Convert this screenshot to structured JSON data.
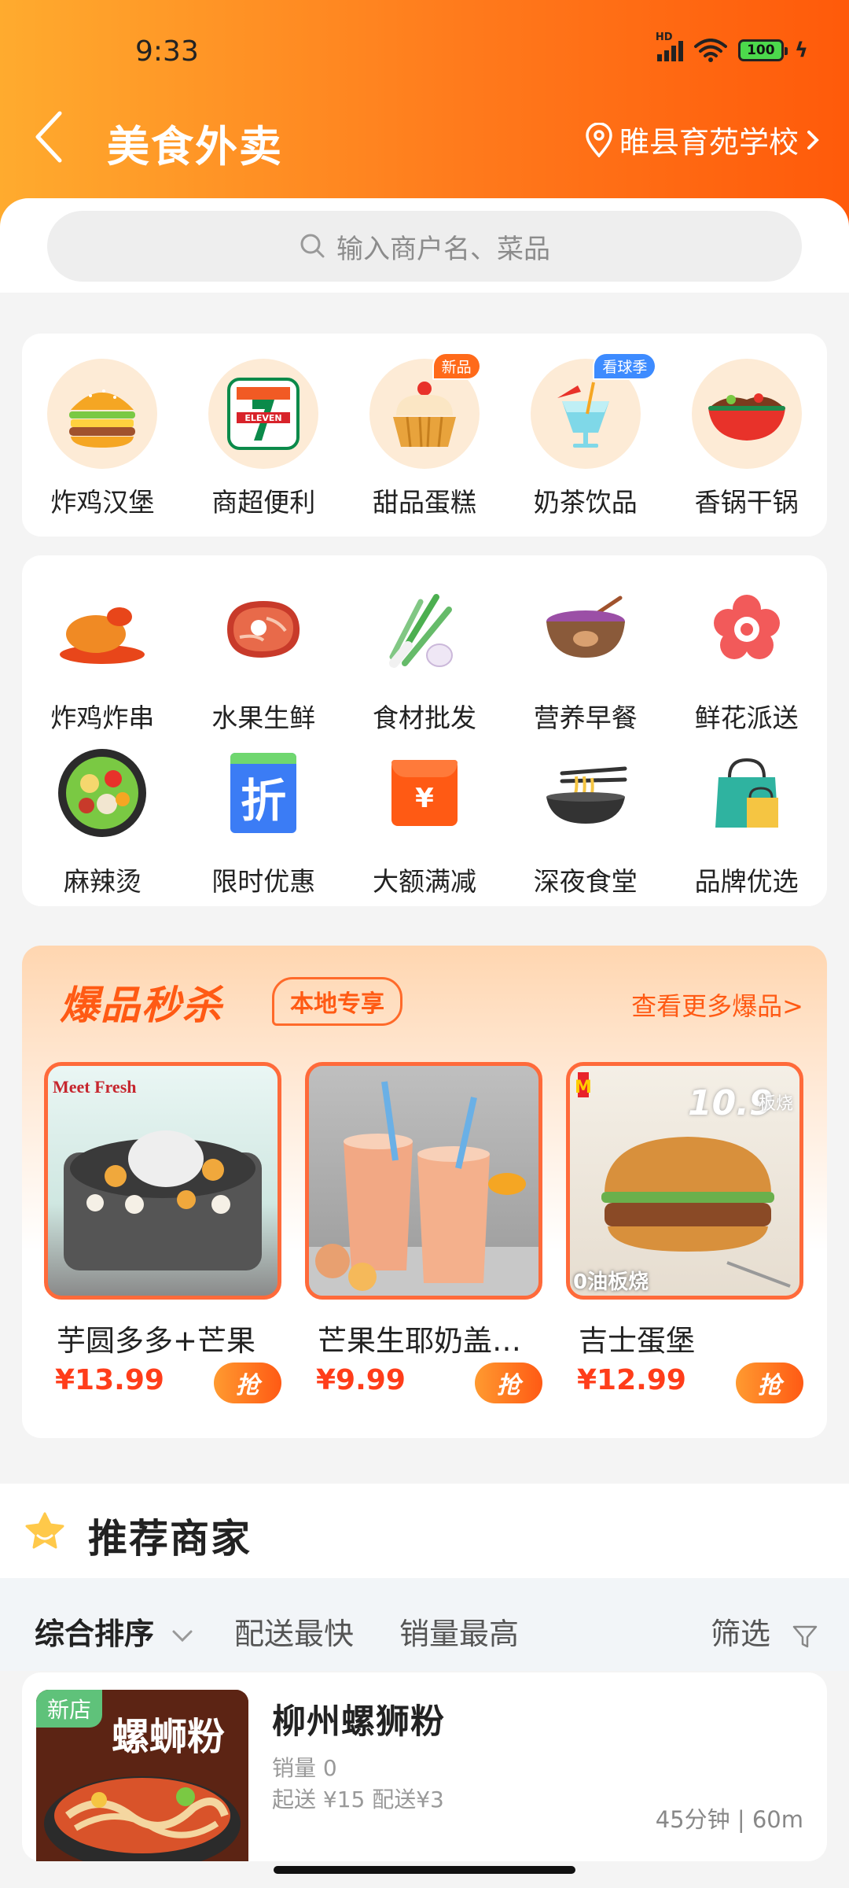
{
  "status_bar": {
    "time": "9:33",
    "network": "HD",
    "battery": "100"
  },
  "header": {
    "title": "美食外卖",
    "location": "睢县育苑学校"
  },
  "search": {
    "placeholder": "输入商户名、菜品"
  },
  "categories_top": [
    {
      "label": "炸鸡汉堡",
      "icon": "burger-icon"
    },
    {
      "label": "商超便利",
      "icon": "seven-eleven-icon"
    },
    {
      "label": "甜品蛋糕",
      "icon": "cupcake-icon",
      "badge": "新品"
    },
    {
      "label": "奶茶饮品",
      "icon": "drink-icon",
      "badge": "看球季"
    },
    {
      "label": "香锅干锅",
      "icon": "hotpot-icon"
    }
  ],
  "categories_row2": [
    {
      "label": "炸鸡炸串",
      "icon": "fried-chicken-icon"
    },
    {
      "label": "水果生鲜",
      "icon": "meat-icon"
    },
    {
      "label": "食材批发",
      "icon": "scallion-icon"
    },
    {
      "label": "营养早餐",
      "icon": "porridge-icon"
    },
    {
      "label": "鲜花派送",
      "icon": "flower-icon"
    }
  ],
  "categories_row3": [
    {
      "label": "麻辣烫",
      "icon": "malatang-icon"
    },
    {
      "label": "限时优惠",
      "icon": "discount-icon",
      "glyph": "折"
    },
    {
      "label": "大额满减",
      "icon": "red-packet-icon",
      "glyph": "¥"
    },
    {
      "label": "深夜食堂",
      "icon": "noodle-bowl-icon"
    },
    {
      "label": "品牌优选",
      "icon": "shopping-bag-icon"
    }
  ],
  "flash_sale": {
    "title": "爆品秒杀",
    "tag": "本地专享",
    "more": "查看更多爆品>",
    "grab_label": "抢",
    "items": [
      {
        "name": "芋圆多多+芒果",
        "price": "¥13.99",
        "brand_text": "Meet Fresh"
      },
      {
        "name": "芒果生耶奶盖…",
        "price": "¥9.99"
      },
      {
        "name": "吉士蛋堡",
        "price": "¥12.99",
        "promo_price": "10.9",
        "promo_tag_1": "板烧",
        "promo_tag_2": "0油板烧"
      }
    ]
  },
  "recommended": {
    "title": "推荐商家",
    "sort": {
      "comprehensive": "综合排序",
      "fastest": "配送最快",
      "top_sales": "销量最高",
      "filter": "筛选"
    },
    "shops": [
      {
        "badge": "新店",
        "name": "柳州螺狮粉",
        "sales": "销量 0",
        "fees": "起送 ¥15   配送¥3",
        "eta": "45分钟 | 60m",
        "image_text": "螺蛳粉"
      }
    ]
  },
  "colors": {
    "accent": "#ff5a14",
    "header_start": "#ffab2e",
    "header_end": "#ff5a0a",
    "price": "#ff3d1a"
  }
}
